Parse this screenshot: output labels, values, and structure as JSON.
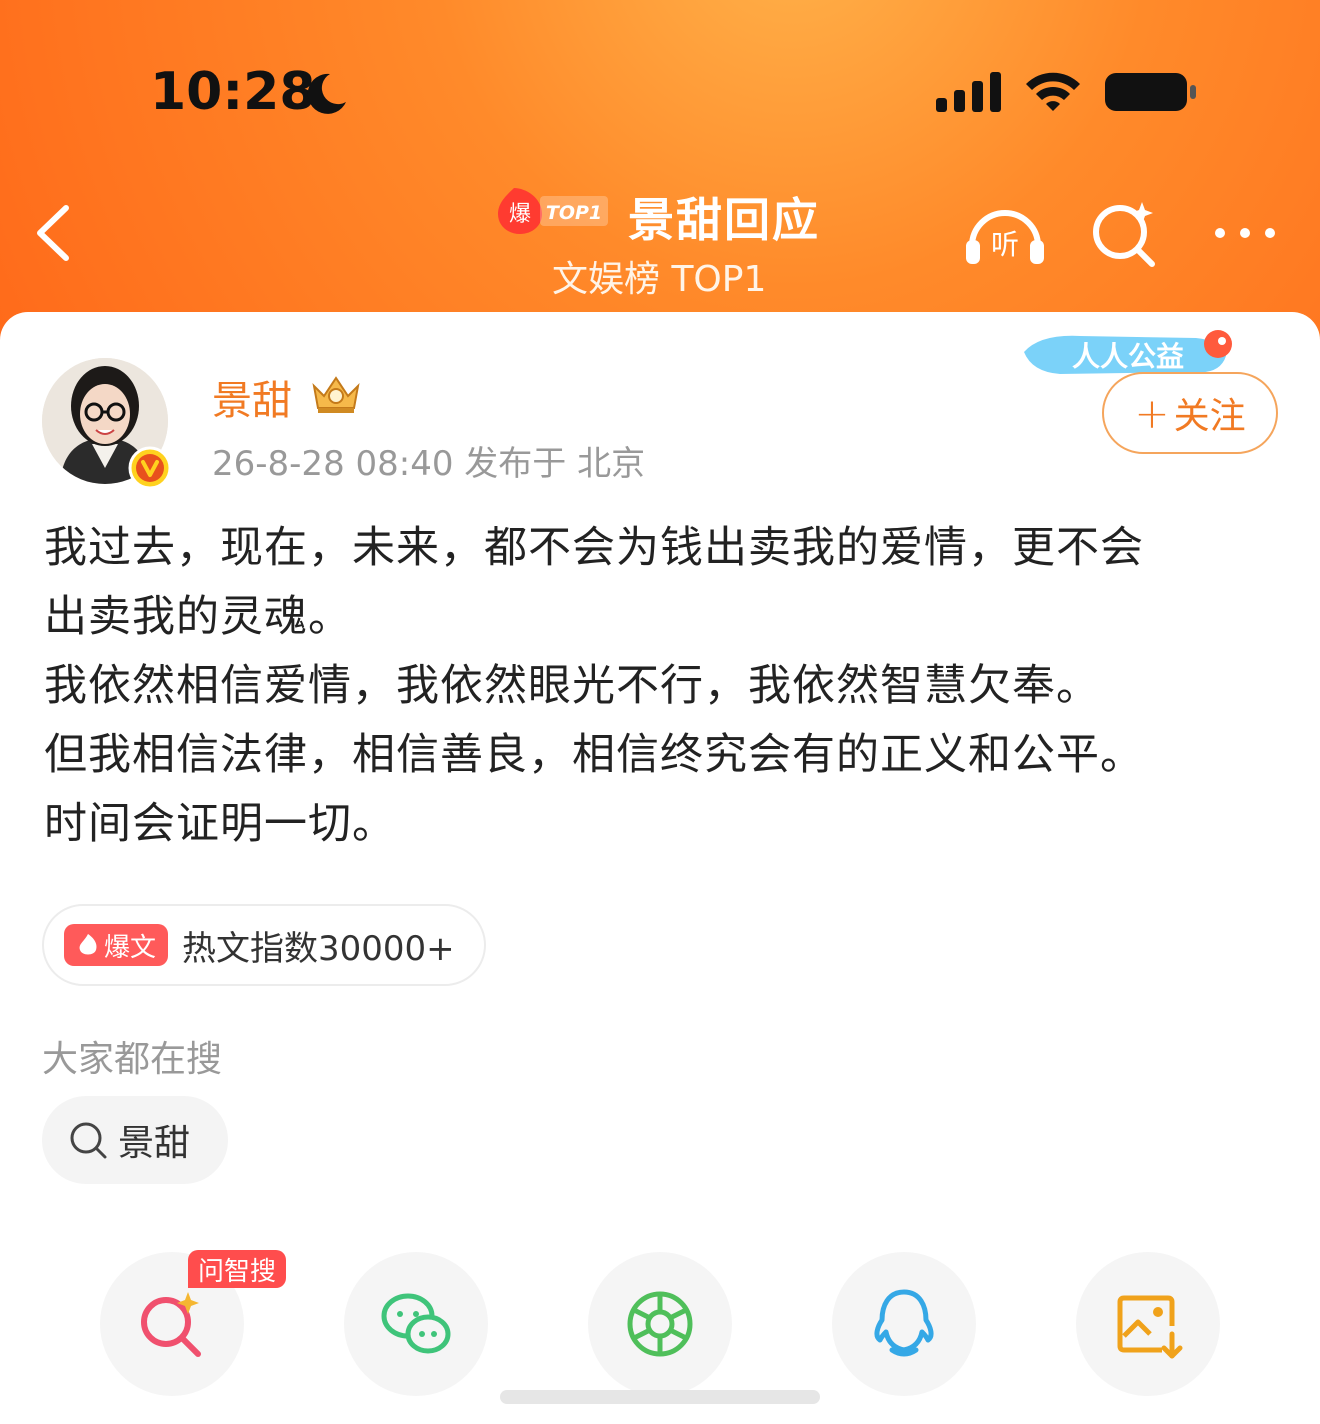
{
  "status_bar": {
    "time": "10:28"
  },
  "nav": {
    "hot_badge_text": "爆",
    "hot_badge_rank": "TOP1",
    "title": "景甜回应",
    "subtitle": "文娱榜 TOP1",
    "listen_label": "听"
  },
  "post": {
    "user_name": "景甜",
    "meta": "26-8-28 08:40  发布于 北京",
    "charity_badge": "人人公益",
    "follow_label": "关注",
    "lines": [
      "我过去，现在，未来，都不会为钱出卖我的爱情，更不会",
      "出卖我的灵魂。",
      "我依然相信爱情，我依然眼光不行，我依然智慧欠奉。",
      "但我相信法律，相信善良，相信终究会有的正义和公平。",
      "时间会证明一切。"
    ],
    "hot_tag": "爆文",
    "hot_index": "热文指数30000+"
  },
  "trending": {
    "label": "大家都在搜",
    "chip": "景甜"
  },
  "share": {
    "ask_badge": "问智搜"
  },
  "colors": {
    "accent": "#f17a23",
    "header": "#ff7a20",
    "wechat": "#3fc47a",
    "moments": "#4fbf5a",
    "qq": "#35a8e6",
    "save": "#f0a21b",
    "search": "#f0506e"
  }
}
